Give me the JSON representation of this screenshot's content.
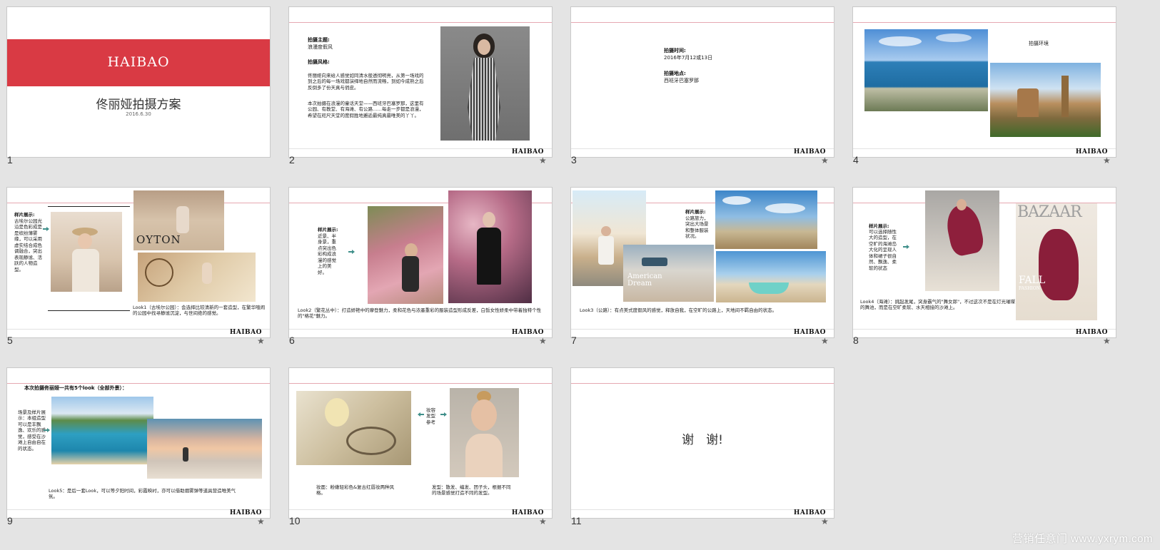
{
  "slides": [
    {
      "num": "1",
      "brand": "HAIBAO",
      "title": "佟丽娅拍摄方案",
      "date": "2016.6.30"
    },
    {
      "num": "2",
      "theme_label": "拍摄主题:",
      "theme_value": "浪漫度假风",
      "style_label": "拍摄风格:",
      "para1": "佟丽娅向来给人感觉如同清水般透彻明亮，从第一场戏的到之后的每一场戏都演绎地自然而流畅，到如今成熟之后反倒多了份天真与俏皮。",
      "para2": "本次拍摄在浪漫的童话天堂——西班牙巴塞罗那，这里有公园、有教堂、有海滩、有公路……每走一步都是浪漫，希望在咫尺天堂的度假胜地邂逅最纯真最唯美的丫丫。",
      "logo": "HAIBAO"
    },
    {
      "num": "3",
      "time_label": "拍摄时间:",
      "time_value": "2016年7月12或13日",
      "place_label": "拍摄地点:",
      "place_value": "西班牙巴塞罗那",
      "logo": "HAIBAO"
    },
    {
      "num": "4",
      "env_label": "拍摄环境",
      "logo": "HAIBAO"
    },
    {
      "num": "5",
      "sample_label": "样片展示:",
      "sample_text": "古埃尔公园光沿是色彩成是是缤纷薄雾缘，可以采用虚实结合成色调融合，突出表现静谧、活跃的人物造型。",
      "mag_word": "OYTON",
      "caption": "Look1（古埃尔公园）：会选择比较清新的一套造型，在繁华喧闹的公园中找寻静谧沉淀，与世间绝的感觉。",
      "logo": "HAIBAO"
    },
    {
      "num": "6",
      "sample_label": "样片展示:",
      "sample_text": "近景、半身景，重点突出色彩构成浪漫的感觉上的美好。",
      "caption": "Look2（繁花丛中）：打造娇艳中的摩登魅力，柔和花色与浓墨重彩的服装造型形成反差，白皙女性娇柔中带着独特个性的\"格花\"魅力。",
      "logo": "HAIBAO"
    },
    {
      "num": "7",
      "sample_label": "样片展示:",
      "sample_text": "公路旅力，突出大场景和整体服装状况。",
      "mag_word": "American Dream",
      "caption": "Look3（公路）：有点美式度假风的感觉，释放自我，在空旷的公路上，天地间不羁自由的状态。",
      "logo": "HAIBAO"
    },
    {
      "num": "8",
      "sample_label": "样片展示:",
      "sample_text": "可以选择随性大的造型，在空旷的海滩岛大化的呈现人体和裙子很自然、飘逸、柔软的状态",
      "mag_word": "BAZAAR",
      "mag_word2": "FALL",
      "mag_word3": "FASHION",
      "caption": "Look4（海滩）：挑起发尾，突身霸气的\"舞女郎\"，不过这次不是在灯光璀璨的舞池，而是在空旷柔软、水天相接的沙滩上。",
      "logo": "HAIBAO"
    },
    {
      "num": "9",
      "heading": "本次拍摄佟丽娅一共有5个look（全部外景）：",
      "sample_text": "场景及样片展示：本组造型可以是丰飘逸、欢乐的感觉，感受在沙滩上自由自在的状态。",
      "caption": "Look5：是后一套Look，可以等夕阳时间，彩霞映衬，亦可以借助烟雾弹等道具营造唯美气氛。",
      "logo": "HAIBAO"
    },
    {
      "num": "10",
      "mid_label": "妆容发型参考",
      "makeup": "妆面：粉嫩轻彩色&复古红唇妆两种风格。",
      "hair": "发型：散发、编发、团子头，根据不同的场景感觉打造不同的发型。",
      "logo": "HAIBAO"
    },
    {
      "num": "11",
      "thanks": "谢　谢!",
      "logo": "HAIBAO"
    }
  ],
  "watermark": "营销任意门 www.yxrym.com",
  "colors": {
    "brand_red": "#d93a44",
    "accent_line": "#e6a8b1",
    "arrow": "#3f8f8a",
    "bg": "#e4e4e4"
  }
}
